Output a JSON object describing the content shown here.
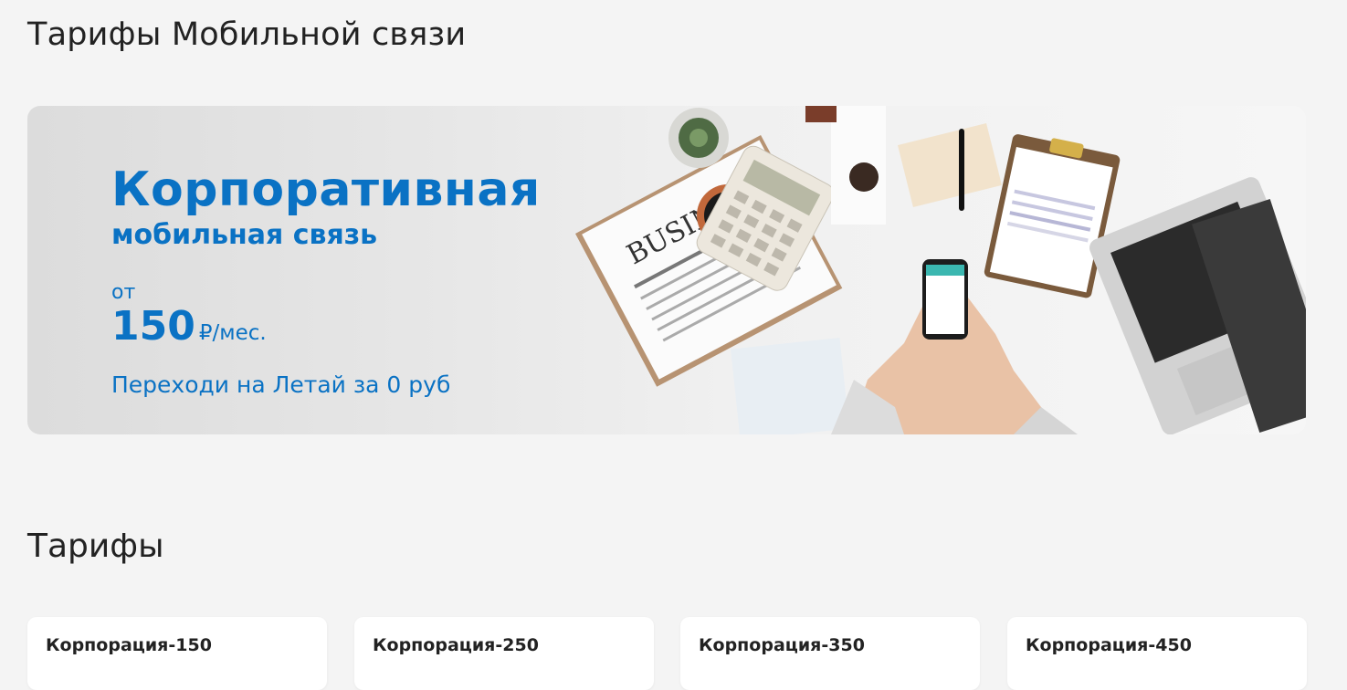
{
  "page": {
    "title": "Тарифы Мобильной связи"
  },
  "banner": {
    "title": "Корпоративная",
    "subtitle": "мобильная связь",
    "price_from": "от",
    "price_value": "150",
    "price_unit": "₽/мес.",
    "promo_link": "Переходи на Летай за 0 руб",
    "newspaper_label": "BUSINESS",
    "accent_color": "#0a72c4"
  },
  "tariffs": {
    "title": "Тарифы",
    "items": [
      {
        "name": "Корпорация-150"
      },
      {
        "name": "Корпорация-250"
      },
      {
        "name": "Корпорация-350"
      },
      {
        "name": "Корпорация-450"
      }
    ]
  }
}
